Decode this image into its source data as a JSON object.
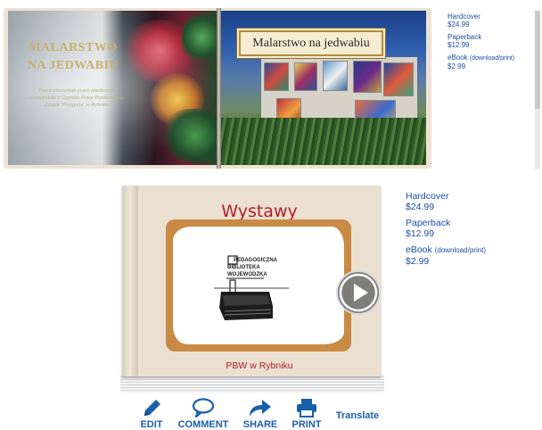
{
  "top_book": {
    "cover_title": "MALARSTWO NA JEDWABIU",
    "cover_subtitle": "Praca prezentuje prace plastyczne uczestników z Ogniska Pracy Pozaszkolnej Zespół \"Przygoda\" w Rybniku",
    "page_title": "Malarstwo na jedwabiu"
  },
  "top_prices": {
    "hardcover_label": "Hardcover",
    "hardcover_price": "$24.99",
    "paperback_label": "Paperback",
    "paperback_price": "$12.99",
    "ebook_label": "eBook",
    "ebook_note": "(download/print)",
    "ebook_price": "$2.99"
  },
  "bottom_book": {
    "title": "Wystawy",
    "subtitle": "PBW w Rybniku",
    "logo_lines": [
      "PEDAGOGICZNA",
      "BIBLIOTEKA",
      "WOJEWÓDZKA"
    ]
  },
  "bottom_prices": {
    "hardcover_label": "Hardcover",
    "hardcover_price": "$24.99",
    "paperback_label": "Paperback",
    "paperback_price": "$12.99",
    "ebook_label": "eBook",
    "ebook_note": "(download/print)",
    "ebook_price": "$2.99"
  },
  "actions": {
    "edit": "EDIT",
    "comment": "COMMENT",
    "share": "SHARE",
    "print": "PRINT",
    "translate": "Translate"
  },
  "colors": {
    "accent": "#1a5fa8",
    "book_title_red": "#b0202a",
    "cover_beige": "#eadfd0"
  },
  "icons": [
    "play-icon",
    "pencil-icon",
    "speech-bubble-icon",
    "share-arrow-icon",
    "printer-icon"
  ]
}
